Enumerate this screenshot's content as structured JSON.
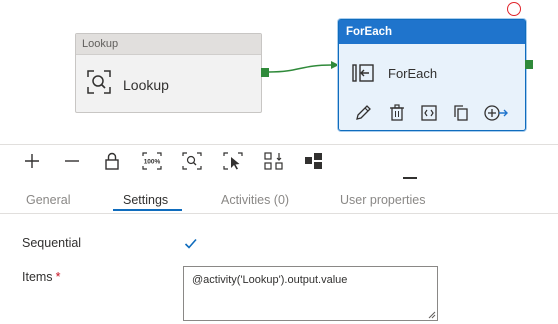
{
  "canvas": {
    "lookup_node": {
      "header": "Lookup",
      "label": "Lookup",
      "icon": "lookup-icon"
    },
    "foreach_node": {
      "header": "ForEach",
      "label": "ForEach",
      "icon": "foreach-icon",
      "actions": [
        "edit-icon",
        "delete-icon",
        "code-icon",
        "copy-icon",
        "add-output-icon"
      ]
    },
    "accent_color": "#1f74cc",
    "port_color": "#2f8a3a"
  },
  "toolbar": {
    "buttons": [
      "zoom-in-icon",
      "zoom-out-icon",
      "lock-icon",
      "zoom-100-icon",
      "zoom-fit-icon",
      "select-icon",
      "auto-align-icon",
      "layout-icon"
    ],
    "zoom_100_text": "100%"
  },
  "tabs": [
    {
      "label": "General",
      "active": false
    },
    {
      "label": "Settings",
      "active": true
    },
    {
      "label": "Activities (0)",
      "active": false
    },
    {
      "label": "User properties",
      "active": false
    }
  ],
  "settings": {
    "sequential_label": "Sequential",
    "sequential_checked": true,
    "items_label": "Items",
    "items_required_mark": "*",
    "items_value": "@activity('Lookup').output.value"
  }
}
